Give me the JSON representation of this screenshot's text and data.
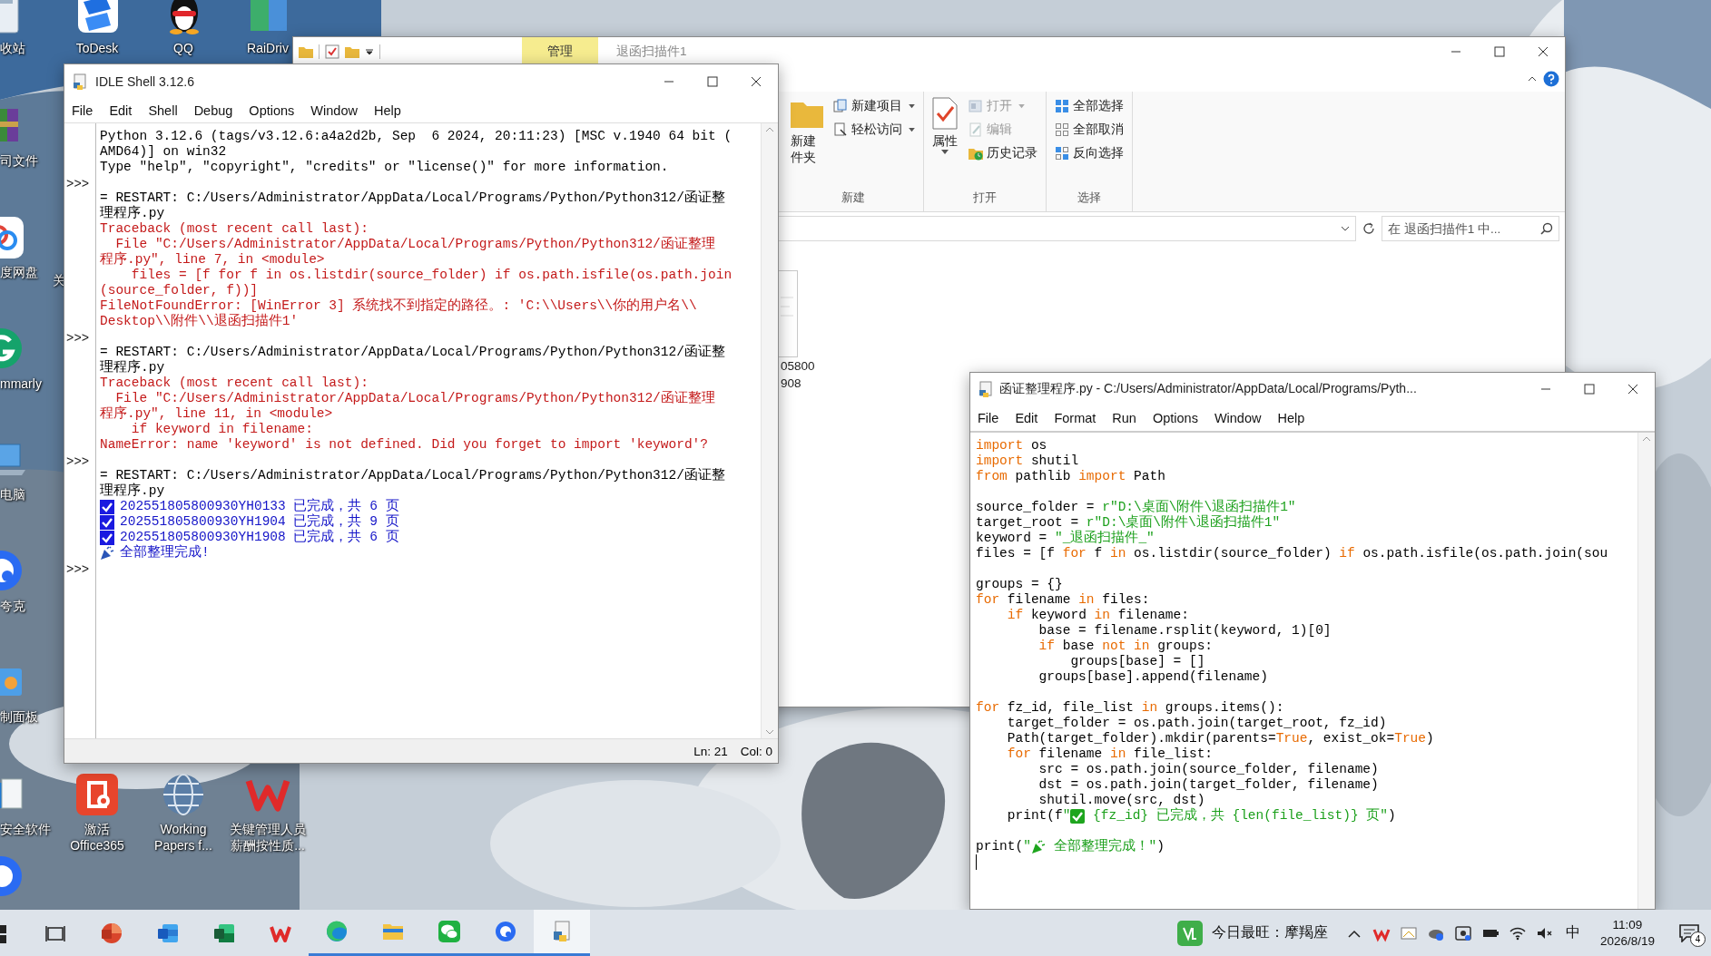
{
  "desktop": {
    "icons": [
      {
        "kind": "recycle",
        "lines": [
          "收站"
        ]
      },
      {
        "kind": "todesk",
        "lines": [
          "ToDesk"
        ]
      },
      {
        "kind": "qq",
        "lines": [
          "QQ"
        ]
      },
      {
        "kind": "raidrive",
        "lines": [
          "RaiDriv"
        ]
      },
      {
        "kind": "archive",
        "lines": [
          "司文件"
        ]
      },
      {
        "kind": "netdisk",
        "lines": [
          "度网盘"
        ]
      },
      {
        "kind": "covered",
        "lines": [
          "关"
        ]
      },
      {
        "kind": "grammarly",
        "lines": [
          "mmarly"
        ]
      },
      {
        "kind": "computer",
        "lines": [
          "电脑"
        ]
      },
      {
        "kind": "quark",
        "lines": [
          "夸克"
        ]
      },
      {
        "kind": "control-panel",
        "lines": [
          "制面板"
        ]
      },
      {
        "kind": "security",
        "lines": [
          "安全软件"
        ]
      },
      {
        "kind": "office",
        "lines": [
          "激活",
          "Office365"
        ]
      },
      {
        "kind": "wpe",
        "lines": [
          "Working",
          "Papers f..."
        ]
      },
      {
        "kind": "wps",
        "lines": [
          "关键管理人员",
          "薪酬按性质..."
        ]
      },
      {
        "kind": "chat"
      }
    ]
  },
  "explorer": {
    "context_tab": "管理",
    "title": "退函扫描件1",
    "ribbon": {
      "groups": [
        {
          "label": "新建",
          "large": {
            "kind": "folder",
            "lines": [
              "新建",
              "件夹"
            ],
            "dropdown": false
          },
          "items": [
            {
              "kind": "new-item",
              "label": "新建项目",
              "dropdown": true,
              "disabled": false
            },
            {
              "kind": "easy-access",
              "label": "轻松访问",
              "dropdown": true,
              "disabled": false
            }
          ]
        },
        {
          "label": "打开",
          "large": {
            "kind": "properties",
            "lines": [
              "属性"
            ],
            "dropdown": true
          },
          "items": [
            {
              "kind": "open",
              "label": "打开",
              "dropdown": true,
              "disabled": true
            },
            {
              "kind": "edit",
              "label": "编辑",
              "dropdown": false,
              "disabled": true
            },
            {
              "kind": "history",
              "label": "历史记录",
              "dropdown": false,
              "disabled": false
            }
          ]
        },
        {
          "label": "选择",
          "items": [
            {
              "kind": "select-all",
              "label": "全部选择",
              "dropdown": false,
              "disabled": false
            },
            {
              "kind": "select-none",
              "label": "全部取消",
              "dropdown": false,
              "disabled": false
            },
            {
              "kind": "invert",
              "label": "反向选择",
              "dropdown": false,
              "disabled": false
            }
          ]
        }
      ]
    },
    "search": {
      "placeholder": "在 退函扫描件1 中..."
    },
    "files": [
      {
        "lines": [
          "05800",
          "908"
        ]
      }
    ]
  },
  "shell": {
    "title": "IDLE Shell 3.12.6",
    "menu": [
      "File",
      "Edit",
      "Shell",
      "Debug",
      "Options",
      "Window",
      "Help"
    ],
    "lines": [
      {
        "kind": "out",
        "text": "Python 3.12.6 (tags/v3.12.6:a4a2d2b, Sep  6 2024, 20:11:23) [MSC v.1940 64 bit ("
      },
      {
        "kind": "out",
        "text": "AMD64)] on win32"
      },
      {
        "kind": "out",
        "text": "Type \"help\", \"copyright\", \"credits\" or \"license()\" for more information."
      },
      {
        "kind": "prompt",
        "prompt": ">>>"
      },
      {
        "kind": "out",
        "text": "= RESTART: C:/Users/Administrator/AppData/Local/Programs/Python/Python312/函证整"
      },
      {
        "kind": "out",
        "text": "理程序.py"
      },
      {
        "kind": "err",
        "text": "Traceback (most recent call last):"
      },
      {
        "kind": "err",
        "text": "  File \"C:/Users/Administrator/AppData/Local/Programs/Python/Python312/函证整理"
      },
      {
        "kind": "err",
        "text": "程序.py\", line 7, in <module>"
      },
      {
        "kind": "err",
        "text": "    files = [f for f in os.listdir(source_folder) if os.path.isfile(os.path.join"
      },
      {
        "kind": "err",
        "text": "(source_folder, f))]"
      },
      {
        "kind": "err",
        "text": "FileNotFoundError: [WinError 3] 系统找不到指定的路径。: 'C:\\\\Users\\\\你的用户名\\\\"
      },
      {
        "kind": "err",
        "text": "Desktop\\\\附件\\\\退函扫描件1'"
      },
      {
        "kind": "prompt",
        "prompt": ">>>"
      },
      {
        "kind": "out",
        "text": "= RESTART: C:/Users/Administrator/AppData/Local/Programs/Python/Python312/函证整"
      },
      {
        "kind": "out",
        "text": "理程序.py"
      },
      {
        "kind": "err",
        "text": "Traceback (most recent call last):"
      },
      {
        "kind": "err",
        "text": "  File \"C:/Users/Administrator/AppData/Local/Programs/Python/Python312/函证整理"
      },
      {
        "kind": "err",
        "text": "程序.py\", line 11, in <module>"
      },
      {
        "kind": "err",
        "text": "    if keyword in filename:"
      },
      {
        "kind": "err",
        "text": "NameError: name 'keyword' is not defined. Did you forget to import 'keyword'?"
      },
      {
        "kind": "prompt",
        "prompt": ">>>"
      },
      {
        "kind": "out",
        "text": "= RESTART: C:/Users/Administrator/AppData/Local/Programs/Python/Python312/函证整"
      },
      {
        "kind": "out",
        "text": "理程序.py"
      },
      {
        "kind": "done",
        "text": "202551805800930YH0133 已完成，共 6 页"
      },
      {
        "kind": "done",
        "text": "202551805800930YH1904 已完成，共 9 页"
      },
      {
        "kind": "done",
        "text": "202551805800930YH1908 已完成，共 6 页"
      },
      {
        "kind": "finish",
        "text": "全部整理完成!"
      },
      {
        "kind": "prompt",
        "prompt": ">>>"
      }
    ],
    "status": {
      "line": "Ln: 21",
      "col": "Col: 0"
    }
  },
  "editor": {
    "title": "函证整理程序.py - C:/Users/Administrator/AppData/Local/Programs/Pyth...",
    "menu": [
      "File",
      "Edit",
      "Format",
      "Run",
      "Options",
      "Window",
      "Help"
    ],
    "lines": [
      {
        "kind": "code",
        "tokens": [
          {
            "t": "import",
            "kind": "keyword"
          },
          {
            "t": " os",
            "kind": "plain"
          }
        ]
      },
      {
        "kind": "code",
        "tokens": [
          {
            "t": "import",
            "kind": "keyword"
          },
          {
            "t": " shutil",
            "kind": "plain"
          }
        ]
      },
      {
        "kind": "code",
        "tokens": [
          {
            "t": "from",
            "kind": "keyword"
          },
          {
            "t": " pathlib ",
            "kind": "plain"
          },
          {
            "t": "import",
            "kind": "keyword"
          },
          {
            "t": " Path",
            "kind": "plain"
          }
        ]
      },
      {
        "kind": "blank"
      },
      {
        "kind": "code",
        "tokens": [
          {
            "t": "source_folder = ",
            "kind": "plain"
          },
          {
            "t": "r\"D:\\桌面\\附件\\退函扫描件1\"",
            "kind": "string"
          }
        ]
      },
      {
        "kind": "code",
        "tokens": [
          {
            "t": "target_root = ",
            "kind": "plain"
          },
          {
            "t": "r\"D:\\桌面\\附件\\退函扫描件1\"",
            "kind": "string"
          }
        ]
      },
      {
        "kind": "code",
        "tokens": [
          {
            "t": "keyword = ",
            "kind": "plain"
          },
          {
            "t": "\"_退函扫描件_\"",
            "kind": "string"
          }
        ]
      },
      {
        "kind": "code",
        "tokens": [
          {
            "t": "files = [f ",
            "kind": "plain"
          },
          {
            "t": "for",
            "kind": "keyword"
          },
          {
            "t": " f ",
            "kind": "plain"
          },
          {
            "t": "in",
            "kind": "keyword"
          },
          {
            "t": " os.listdir(source_folder) ",
            "kind": "plain"
          },
          {
            "t": "if",
            "kind": "keyword"
          },
          {
            "t": " os.path.isfile(os.path.join(sou",
            "kind": "plain"
          }
        ]
      },
      {
        "kind": "blank"
      },
      {
        "kind": "code",
        "tokens": [
          {
            "t": "groups = {}",
            "kind": "plain"
          }
        ]
      },
      {
        "kind": "code",
        "tokens": [
          {
            "t": "for",
            "kind": "keyword"
          },
          {
            "t": " filename ",
            "kind": "plain"
          },
          {
            "t": "in",
            "kind": "keyword"
          },
          {
            "t": " files:",
            "kind": "plain"
          }
        ]
      },
      {
        "kind": "code",
        "tokens": [
          {
            "t": "    if",
            "kind": "keyword"
          },
          {
            "t": " keyword ",
            "kind": "plain"
          },
          {
            "t": "in",
            "kind": "keyword"
          },
          {
            "t": " filename:",
            "kind": "plain"
          }
        ]
      },
      {
        "kind": "code",
        "tokens": [
          {
            "t": "        base = filename.rsplit(keyword, 1)[0]",
            "kind": "plain"
          }
        ]
      },
      {
        "kind": "code",
        "tokens": [
          {
            "t": "        if",
            "kind": "keyword"
          },
          {
            "t": " base ",
            "kind": "plain"
          },
          {
            "t": "not in",
            "kind": "keyword"
          },
          {
            "t": " groups:",
            "kind": "plain"
          }
        ]
      },
      {
        "kind": "code",
        "tokens": [
          {
            "t": "            groups[base] = []",
            "kind": "plain"
          }
        ]
      },
      {
        "kind": "code",
        "tokens": [
          {
            "t": "        groups[base].append(filename)",
            "kind": "plain"
          }
        ]
      },
      {
        "kind": "blank"
      },
      {
        "kind": "code",
        "tokens": [
          {
            "t": "for",
            "kind": "keyword"
          },
          {
            "t": " fz_id, file_list ",
            "kind": "plain"
          },
          {
            "t": "in",
            "kind": "keyword"
          },
          {
            "t": " groups.items():",
            "kind": "plain"
          }
        ]
      },
      {
        "kind": "code",
        "tokens": [
          {
            "t": "    target_folder = os.path.join(target_root, fz_id)",
            "kind": "plain"
          }
        ]
      },
      {
        "kind": "code",
        "tokens": [
          {
            "t": "    Path(target_folder).mkdir(parents=",
            "kind": "plain"
          },
          {
            "t": "True",
            "kind": "keyword"
          },
          {
            "t": ", exist_ok=",
            "kind": "plain"
          },
          {
            "t": "True",
            "kind": "keyword"
          },
          {
            "t": ")",
            "kind": "plain"
          }
        ]
      },
      {
        "kind": "code",
        "tokens": [
          {
            "t": "    for",
            "kind": "keyword"
          },
          {
            "t": " filename ",
            "kind": "plain"
          },
          {
            "t": "in",
            "kind": "keyword"
          },
          {
            "t": " file_list:",
            "kind": "plain"
          }
        ]
      },
      {
        "kind": "code",
        "tokens": [
          {
            "t": "        src = os.path.join(source_folder, filename)",
            "kind": "plain"
          }
        ]
      },
      {
        "kind": "code",
        "tokens": [
          {
            "t": "        dst = os.path.join(target_folder, filename)",
            "kind": "plain"
          }
        ]
      },
      {
        "kind": "code",
        "tokens": [
          {
            "t": "        shutil.move(src, dst)",
            "kind": "plain"
          }
        ]
      },
      {
        "kind": "code",
        "tokens": [
          {
            "t": "    print(f",
            "kind": "plain"
          },
          {
            "t": "\"",
            "kind": "string"
          },
          {
            "kind": "check"
          },
          {
            "t": " {fz_id} 已完成，共 {len(file_list)} 页\"",
            "kind": "string"
          },
          {
            "t": ")",
            "kind": "plain"
          }
        ]
      },
      {
        "kind": "blank"
      },
      {
        "kind": "code",
        "tokens": [
          {
            "t": "print(",
            "kind": "plain"
          },
          {
            "t": "\"",
            "kind": "string"
          },
          {
            "kind": "party"
          },
          {
            "t": " 全部整理完成！\"",
            "kind": "string"
          },
          {
            "t": ")",
            "kind": "plain"
          }
        ]
      },
      {
        "kind": "cursor"
      }
    ]
  },
  "taskbar": {
    "apps": [
      {
        "kind": "start",
        "running": false,
        "active": false
      },
      {
        "kind": "task-view",
        "running": false,
        "active": false
      },
      {
        "kind": "presentation",
        "running": false,
        "active": false
      },
      {
        "kind": "word",
        "running": false,
        "active": false
      },
      {
        "kind": "excel",
        "running": false,
        "active": false
      },
      {
        "kind": "wps",
        "running": false,
        "active": false
      },
      {
        "kind": "edge",
        "running": true,
        "active": false
      },
      {
        "kind": "explorer",
        "running": true,
        "active": false
      },
      {
        "kind": "wechat",
        "running": true,
        "active": false
      },
      {
        "kind": "bluecircle",
        "running": true,
        "active": false
      },
      {
        "kind": "idle",
        "running": true,
        "active": true
      }
    ],
    "widget": "今日最旺：摩羯座",
    "ime": "中",
    "time": "11:09",
    "date": "2026/8/19",
    "notifications": "4"
  }
}
